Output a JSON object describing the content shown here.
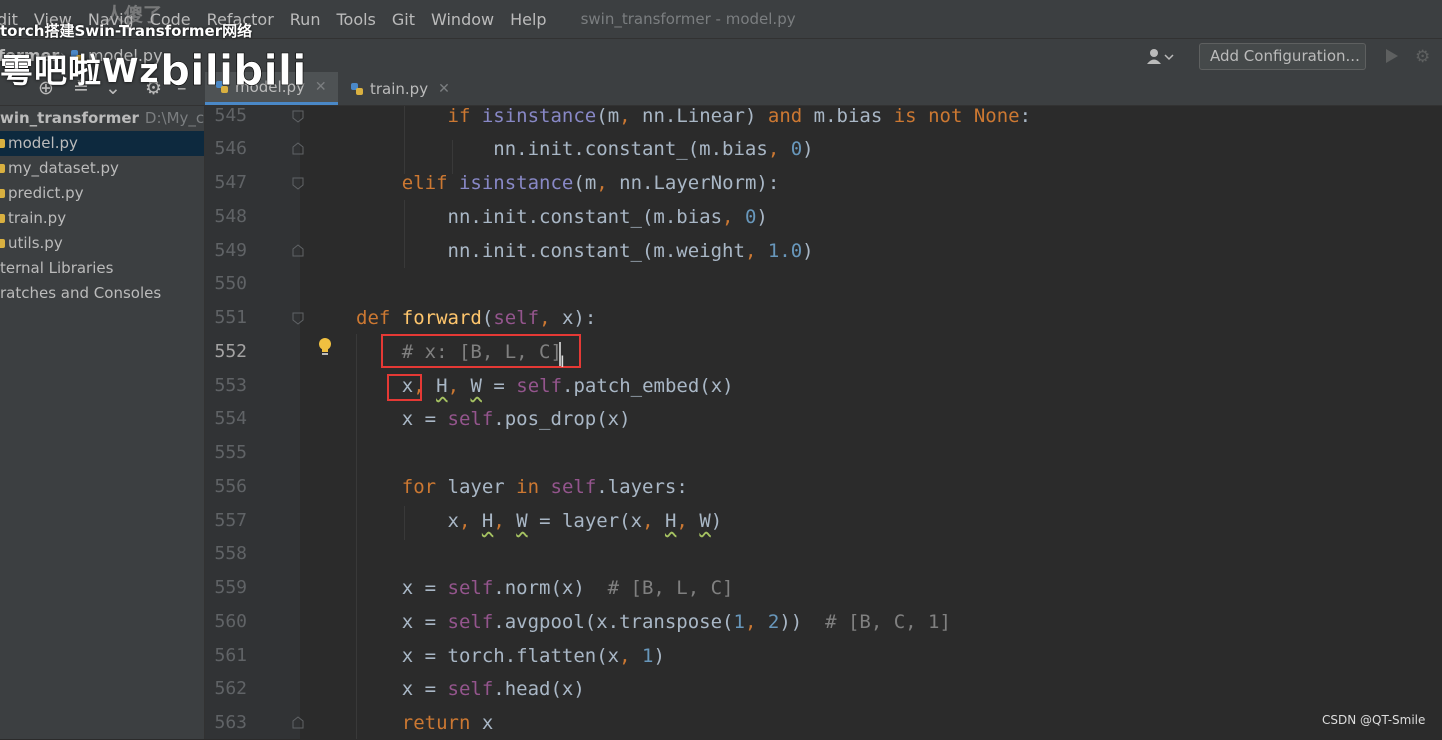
{
  "menu": {
    "items": [
      "dit",
      "View",
      "Navig",
      "Code",
      "Refactor",
      "Run",
      "Tools",
      "Git",
      "Window",
      "Help"
    ],
    "window_title": "swin_transformer - model.py"
  },
  "watermark": {
    "top_line": "torch搭建Swin-Transformer网络",
    "name": "雩吧啦Wz",
    "header": "人傻了",
    "bilibili": "bilibili",
    "csdn": "CSDN @QT-Smile"
  },
  "breadcrumb": {
    "root": "former",
    "file": "model.py"
  },
  "toolbar": {
    "add_configuration": "Add Configuration..."
  },
  "tabs": [
    {
      "label": "model.py",
      "active": true
    },
    {
      "label": "train.py",
      "active": false
    }
  ],
  "project_tree": {
    "root_name": "win_transformer",
    "root_path": "D:\\My_code",
    "files": [
      "model.py",
      "my_dataset.py",
      "predict.py",
      "train.py",
      "utils.py"
    ],
    "extras": [
      "ternal Libraries",
      "ratches and Consoles"
    ]
  },
  "editor": {
    "line_numbers": [
      "545",
      "546",
      "547",
      "548",
      "549",
      "550",
      "551",
      "552",
      "553",
      "554",
      "555",
      "556",
      "557",
      "558",
      "559",
      "560",
      "561",
      "562",
      "563"
    ],
    "current_line": "552",
    "lines": [
      "        if isinstance(m, nn.Linear) and m.bias is not None:",
      "            nn.init.constant_(m.bias, 0)",
      "    elif isinstance(m, nn.LayerNorm):",
      "        nn.init.constant_(m.bias, 0)",
      "        nn.init.constant_(m.weight, 1.0)",
      "",
      "def forward(self, x):",
      "    # x: [B, L, C]",
      "    x, H, W = self.patch_embed(x)",
      "    x = self.pos_drop(x)",
      "",
      "    for layer in self.layers:",
      "        x, H, W = layer(x, H, W)",
      "",
      "    x = self.norm(x)  # [B, L, C]",
      "    x = self.avgpool(x.transpose(1, 2))  # [B, C, 1]",
      "    x = torch.flatten(x, 1)",
      "    x = self.head(x)",
      "    return x"
    ]
  },
  "colors": {
    "keyword": "#cc7832",
    "self": "#94558d",
    "number": "#6897bb",
    "comment": "#808080",
    "function_name": "#ffc66d",
    "builtin": "#8888c6",
    "highlight_box": "#e53935"
  }
}
